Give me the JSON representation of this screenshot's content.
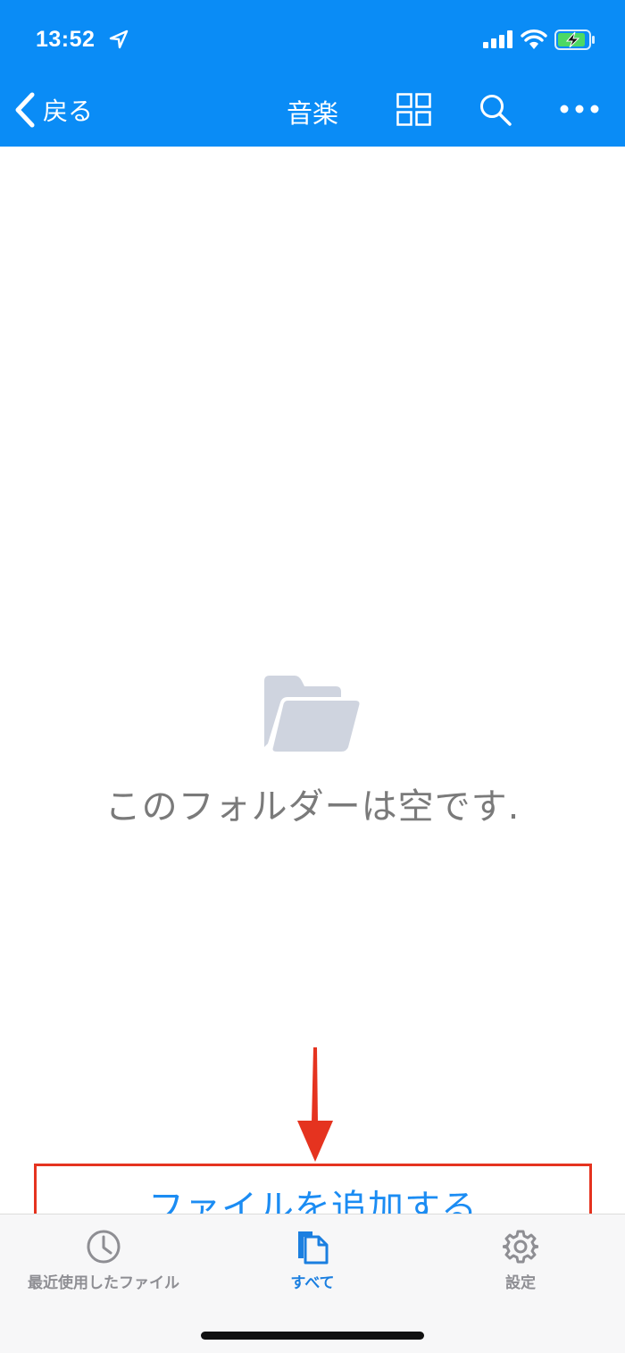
{
  "status_bar": {
    "time": "13:52"
  },
  "nav": {
    "back_label": "戻る",
    "title": "音楽"
  },
  "empty_state": {
    "message": "このフォルダーは空です."
  },
  "add_file": {
    "label": "ファイルを追加する"
  },
  "tabbar": {
    "items": [
      {
        "label": "最近使用したファイル",
        "icon": "clock-icon"
      },
      {
        "label": "すべて",
        "icon": "documents-icon",
        "active": true
      },
      {
        "label": "設定",
        "icon": "gear-icon"
      }
    ]
  },
  "colors": {
    "nav_background": "#0a8cf6",
    "accent": "#1b8cf3",
    "highlight_border": "#e5331f",
    "arrow": "#e5331f"
  }
}
